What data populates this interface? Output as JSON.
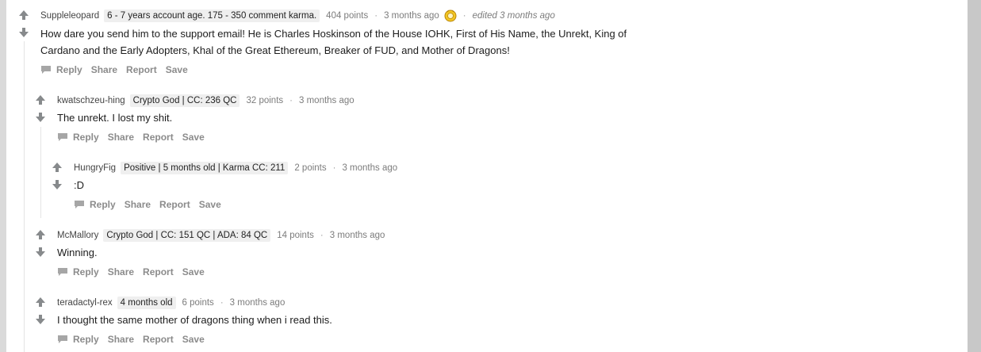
{
  "comments": [
    {
      "author": "Suppleleopard",
      "flair": "6 - 7 years account age. 175 - 350 comment karma.",
      "points": "404 points",
      "time": "3 months ago",
      "edited": "edited 3 months ago",
      "body_line1": "How dare you send him to the support email! He is Charles Hoskinson of the House IOHK, First of His Name, the Unrekt, King of",
      "body_line2": "Cardano and the Early Adopters, Khal of the Great Ethereum, Breaker of FUD, and Mother of Dragons!"
    },
    {
      "author": "kwatschzeu-hing",
      "flair": "Crypto God | CC: 236 QC",
      "points": "32 points",
      "time": "3 months ago",
      "body": "The unrekt. I lost my shit."
    },
    {
      "author": "HungryFig",
      "flair": "Positive | 5 months old | Karma CC: 211",
      "points": "2 points",
      "time": "3 months ago",
      "body": ":D"
    },
    {
      "author": "McMallory",
      "flair": "Crypto God | CC: 151 QC | ADA: 84 QC",
      "points": "14 points",
      "time": "3 months ago",
      "body": "Winning."
    },
    {
      "author": "teradactyl-rex",
      "flair": "4 months old",
      "points": "6 points",
      "time": "3 months ago",
      "body": "I thought the same mother of dragons thing when i read this."
    }
  ],
  "actions": {
    "reply": "Reply",
    "share": "Share",
    "report": "Report",
    "save": "Save"
  },
  "separator": "·",
  "icons": {
    "upvote": "arrow-up-icon",
    "downvote": "arrow-down-icon",
    "reply": "comment-bubble-icon",
    "award": "award-icon"
  },
  "colors": {
    "arrow": "#878a8c",
    "flair_bg": "#efefef",
    "meta": "#7c7c7c",
    "text": "#1c1c1c"
  }
}
